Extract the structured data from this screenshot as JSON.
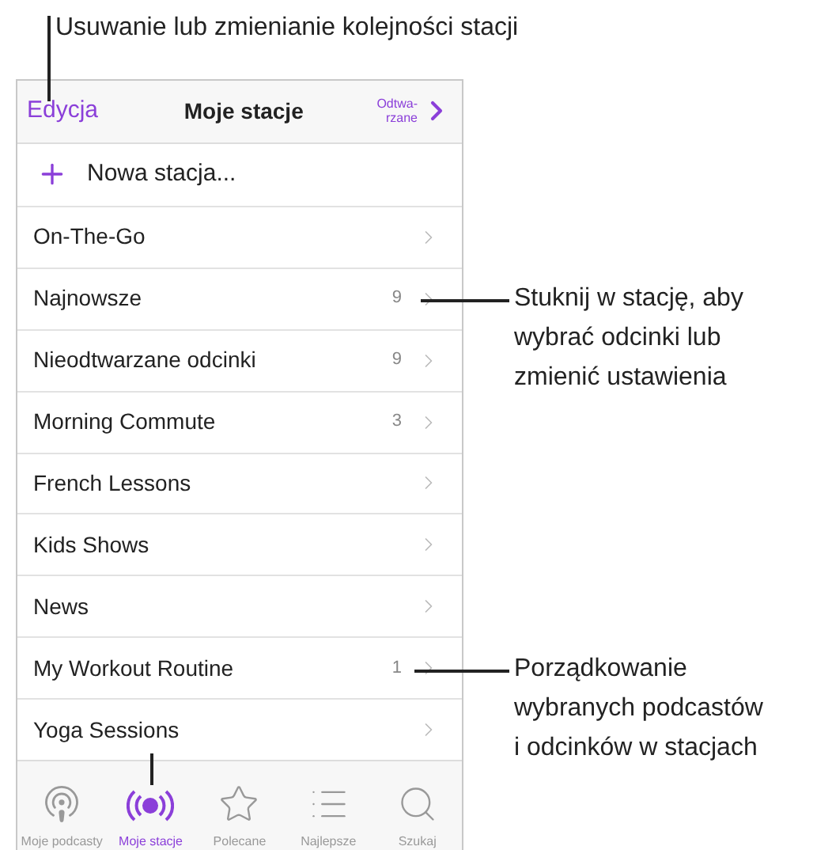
{
  "callouts": [
    {
      "lines": [
        "Usuwanie lub zmienianie kolejności stacji"
      ]
    },
    {
      "lines": [
        "Stuknij w stację, aby",
        "wybrać odcinki lub",
        "zmienić ustawienia"
      ]
    },
    {
      "lines": [
        "Porządkowanie",
        "wybranych podcastów",
        "i odcinków w stacjach"
      ]
    }
  ],
  "nav": {
    "left": "Edycja",
    "title": "Moje stacje",
    "right": [
      "Odtwa-",
      "rzane"
    ]
  },
  "new_station": "Nowa stacja...",
  "stations": [
    {
      "name": "On-The-Go"
    },
    {
      "name": "Najnowsze",
      "count": "9"
    },
    {
      "name": "Nieodtwarzane odcinki",
      "count": "9"
    },
    {
      "name": "Morning Commute",
      "count": "3"
    },
    {
      "name": "French Lessons"
    },
    {
      "name": "Kids Shows"
    },
    {
      "name": "News"
    },
    {
      "name": "My Workout Routine",
      "count": "1"
    },
    {
      "name": "Yoga Sessions"
    }
  ],
  "tab_bar": [
    {
      "kind": "podcasts",
      "label": "Moje podcasty",
      "selected": false
    },
    {
      "kind": "stations",
      "label": "Moje stacje",
      "selected": true
    },
    {
      "kind": "featured",
      "label": "Polecane",
      "selected": false
    },
    {
      "kind": "top",
      "label": "Najlepsze",
      "selected": false
    },
    {
      "kind": "search",
      "label": "Szukaj",
      "selected": false
    }
  ]
}
